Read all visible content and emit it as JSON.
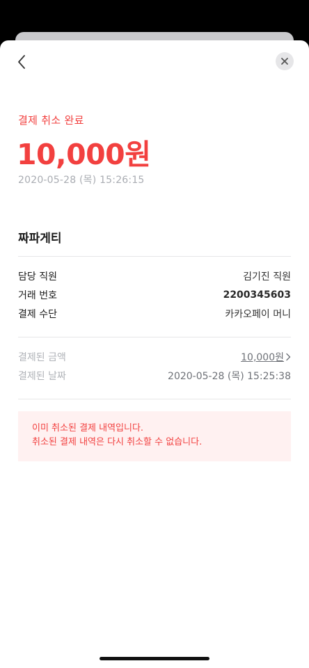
{
  "header": {
    "back_icon": "chevron-left-icon",
    "close_icon": "close-icon"
  },
  "summary": {
    "status": "결제 취소 완료",
    "amount": "10,000원",
    "datetime": "2020-05-28 (목) 15:26:15"
  },
  "store": {
    "name": "짜파게티"
  },
  "details": [
    {
      "label": "담당 직원",
      "value": "김기진 직원"
    },
    {
      "label": "거래 번호",
      "value": "2200345603"
    },
    {
      "label": "결제 수단",
      "value": "카카오페이 머니"
    }
  ],
  "paid": {
    "amount_label": "결제된 금액",
    "amount_value": "10,000원",
    "date_label": "결제된 날짜",
    "date_value": "2020-05-28 (목) 15:25:38"
  },
  "notice": {
    "line1": "이미 취소된 결제 내역입니다.",
    "line2": "취소된 결제 내역은 다시 취소할 수 없습니다."
  },
  "colors": {
    "accent": "#f2403f",
    "notice_bg": "#fff1f1",
    "muted": "#a9acb2"
  }
}
